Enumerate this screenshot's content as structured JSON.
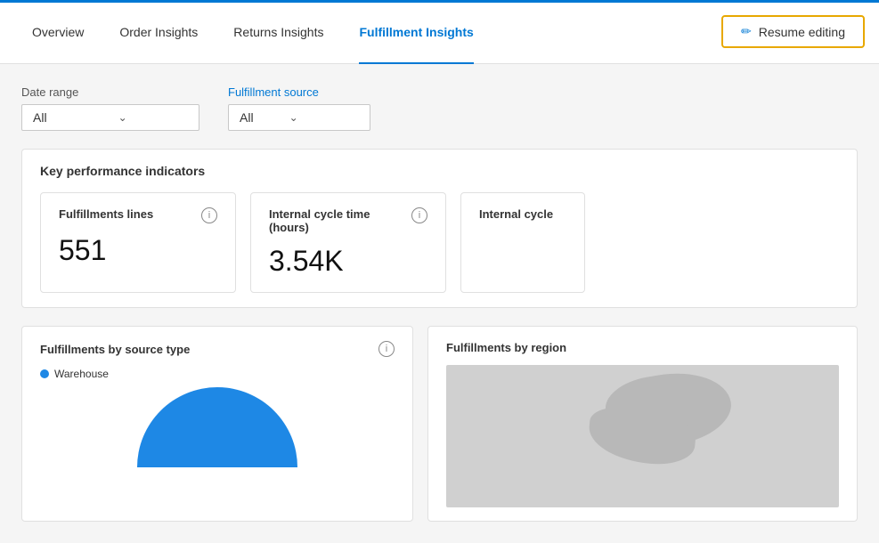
{
  "nav": {
    "tabs": [
      {
        "id": "overview",
        "label": "Overview",
        "active": false
      },
      {
        "id": "order-insights",
        "label": "Order Insights",
        "active": false
      },
      {
        "id": "returns-insights",
        "label": "Returns Insights",
        "active": false
      },
      {
        "id": "fulfillment-insights",
        "label": "Fulfillment Insights",
        "active": true
      }
    ],
    "resume_editing_label": "Resume editing",
    "pencil_icon": "✏"
  },
  "filters": {
    "date_range": {
      "label": "Date range",
      "value": "All",
      "placeholder": "All"
    },
    "fulfillment_source": {
      "label": "Fulfillment source",
      "value": "All",
      "placeholder": "All"
    }
  },
  "kpi": {
    "section_title": "Key performance indicators",
    "cards": [
      {
        "label": "Fulfillments lines",
        "value": "551"
      },
      {
        "label": "Internal cycle time (hours)",
        "value": "3.54K"
      },
      {
        "label": "Internal cycle",
        "value": ""
      }
    ]
  },
  "charts": {
    "by_source_type": {
      "title": "Fulfillments by source type",
      "legend": [
        {
          "label": "Warehouse",
          "color": "#1e88e5"
        }
      ]
    },
    "by_region": {
      "title": "Fulfillments by region"
    }
  },
  "colors": {
    "accent_blue": "#0078d4",
    "accent_yellow": "#e8a800",
    "kpi_value": "#111111",
    "info_icon": "#888888"
  }
}
